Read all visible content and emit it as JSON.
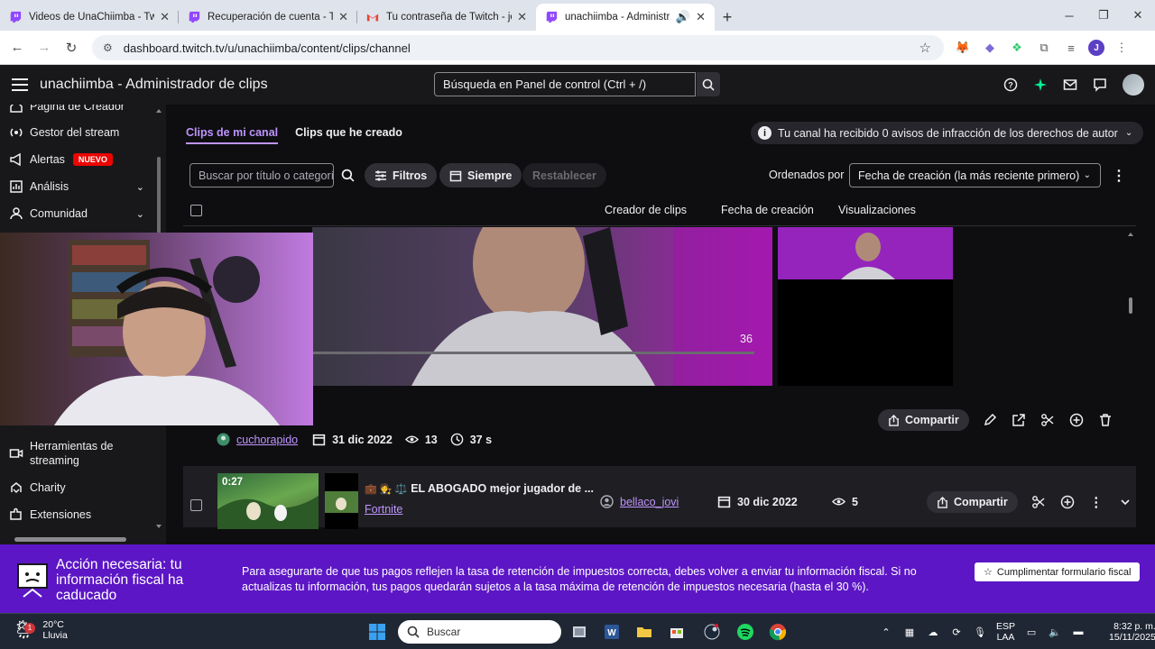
{
  "browser": {
    "tabs": [
      {
        "title": "Videos de UnaChiimba - Twitch",
        "icon": "twitch-icon"
      },
      {
        "title": "Recuperación de cuenta - Twitch",
        "icon": "twitch-icon"
      },
      {
        "title": "Tu contraseña de Twitch - jeiss",
        "icon": "gmail-icon"
      },
      {
        "title": "unachiimba - Administrador",
        "icon": "twitch-icon",
        "active": true
      }
    ],
    "url": "dashboard.twitch.tv/u/unachiimba/content/clips/channel",
    "profile_initial": "J"
  },
  "header": {
    "title": "unachiimba - Administrador de clips",
    "search_placeholder": "Búsqueda en Panel de control (Ctrl + /)"
  },
  "sidebar": {
    "items": [
      {
        "label": "Página de Creador",
        "icon": "home-icon"
      },
      {
        "label": "Gestor del stream",
        "icon": "broadcast-icon"
      },
      {
        "label": "Alertas",
        "icon": "megaphone-icon",
        "badge": "NUEVO"
      },
      {
        "label": "Análisis",
        "icon": "chart-icon",
        "expandable": true
      },
      {
        "label": "Comunidad",
        "icon": "community-icon",
        "expandable": true
      },
      {
        "label": "Herramientas de streaming",
        "icon": "camera-icon"
      },
      {
        "label": "Charity",
        "icon": "charity-icon"
      },
      {
        "label": "Extensiones",
        "icon": "extension-icon"
      }
    ]
  },
  "main": {
    "tabs": [
      {
        "label": "Clips de mi canal",
        "active": true
      },
      {
        "label": "Clips que he creado"
      }
    ],
    "copyright_notice": "Tu canal ha recibido 0 avisos de infracción de los derechos de autor",
    "filters": {
      "search_placeholder": "Buscar por título o categoría",
      "filters_label": "Filtros",
      "time_label": "Siempre",
      "reset_label": "Restablecer",
      "sort_label": "Ordenados por",
      "sort_value": "Fecha de creación (la más reciente primero)"
    },
    "columns": [
      "Creador de clips",
      "Fecha de creación",
      "Visualizaciones"
    ],
    "preview_counter": "36",
    "rows": [
      {
        "creator": "cuchorapido",
        "date": "31 dic 2022",
        "views": "13",
        "duration": "37 s",
        "share_label": "Compartir"
      },
      {
        "duration": "0:27",
        "title_emojis": "💼 🧑‍⚖️ ⚖️",
        "title": "EL ABOGADO mejor jugador de ...",
        "game": "Fortnite",
        "creator": "bellaco_jovi",
        "date": "30 dic 2022",
        "views": "5",
        "share_label": "Compartir"
      }
    ]
  },
  "banner": {
    "title": "Acción necesaria: tu información fiscal ha caducado",
    "text": "Para asegurarte de que tus pagos reflejen la tasa de retención de impuestos correcta, debes volver a enviar tu información fiscal. Si no actualizas tu información, tus pagos quedarán sujetos a la tasa máxima de retención de impuestos necesaria (hasta el 30 %).",
    "button": "Cumplimentar formulario fiscal"
  },
  "taskbar": {
    "weather_temp": "20°C",
    "weather_desc": "Lluvia",
    "weather_badge": "1",
    "search_placeholder": "Buscar",
    "lang": "ESP",
    "lang2": "LAA",
    "time": "8:32 p. m.",
    "date": "15/11/2025"
  },
  "colors": {
    "twitch_purple": "#9147ff",
    "link_purple": "#bf94ff",
    "banner_purple": "#5c16c5",
    "alert_red": "#eb0400"
  }
}
